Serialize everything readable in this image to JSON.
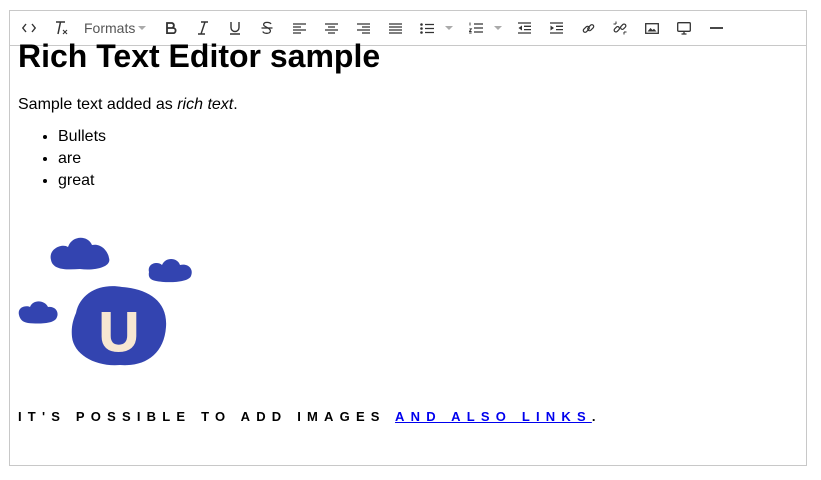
{
  "toolbar": {
    "formats_label": "Formats",
    "buttons": [
      "source-code",
      "clear-formatting",
      "bold",
      "italic",
      "underline",
      "strikethrough",
      "align-left",
      "align-center",
      "align-right",
      "justify",
      "bullet-list",
      "numbered-list",
      "outdent",
      "indent",
      "link",
      "unlink",
      "image",
      "media",
      "horizontal-rule"
    ]
  },
  "content": {
    "heading": "Rich Text Editor sample",
    "paragraph_prefix": "Sample text added as ",
    "paragraph_italic": "rich text",
    "paragraph_suffix": ".",
    "bullets": [
      "Bullets",
      "are",
      "great"
    ],
    "logo_letter": "U",
    "caps_text": "IT'S POSSIBLE TO ADD IMAGES ",
    "caps_link": "AND ALSO LINKS",
    "caps_suffix": "."
  },
  "colors": {
    "logo_blue": "#3344b0",
    "logo_letter": "#f7e7d2",
    "link": "#0000ee",
    "border": "#c8c8c8"
  }
}
